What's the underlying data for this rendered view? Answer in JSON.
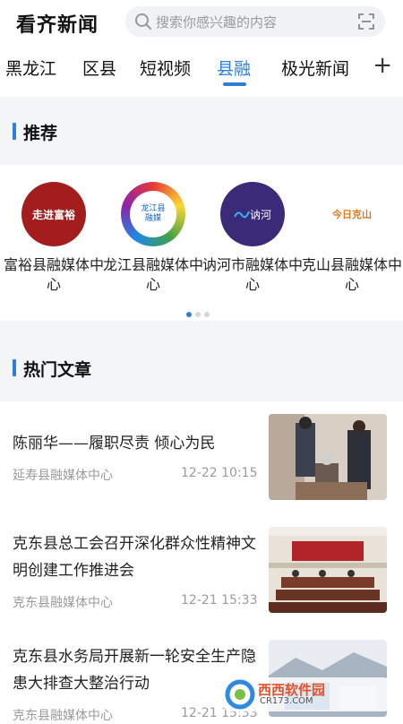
{
  "header": {
    "app_title": "看齐新闻",
    "search_placeholder": "搜索你感兴趣的内容"
  },
  "tabs": [
    {
      "label": "黑龙江",
      "active": false
    },
    {
      "label": "区县",
      "active": false
    },
    {
      "label": "短视频",
      "active": false
    },
    {
      "label": "县融",
      "active": true
    },
    {
      "label": "极光新闻",
      "active": false
    }
  ],
  "add_tab": "+",
  "recommend": {
    "title": "推荐",
    "items": [
      {
        "name": "富裕县融媒体中心",
        "logo_text": "走进富裕"
      },
      {
        "name": "龙江县融媒体中心",
        "logo_text": "龙江县融媒"
      },
      {
        "name": "讷河市融媒体中心",
        "logo_text": "讷河"
      },
      {
        "name": "克山县融媒体中心",
        "logo_text": "今日克山"
      }
    ],
    "page_count": 3,
    "current_page": 1
  },
  "hot": {
    "title": "热门文章",
    "articles": [
      {
        "title": "陈丽华——履职尽责 倾心为民",
        "source": "延寿县融媒体中心",
        "time": "12-22 10:15"
      },
      {
        "title": "克东县总工会召开深化群众性精神文明创建工作推进会",
        "source": "克东县融媒体中心",
        "time": "12-21 15:33"
      },
      {
        "title": "克东县水务局开展新一轮安全生产隐患大排查大整治行动",
        "source": "克东县融媒体中心",
        "time": "12-21 15:33"
      }
    ]
  },
  "watermark": {
    "brand": "西西软件园",
    "domain": "CR173.COM"
  },
  "colors": {
    "accent": "#2f7fd8",
    "band": "#f4f5f7"
  }
}
